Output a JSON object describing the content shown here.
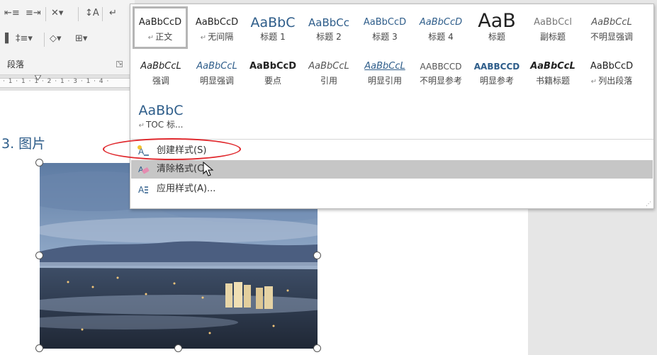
{
  "ribbon": {
    "group_label": "段落",
    "ruler_text": "· 1 · 1 · 1 · 2 · 1 · 3 · 1 · 4 ·"
  },
  "document": {
    "heading": "3. 图片"
  },
  "style_gallery": {
    "items": [
      {
        "sample": "AaBbCcD",
        "name": "正文"
      },
      {
        "sample": "AaBbCcD",
        "name": "无间隔"
      },
      {
        "sample": "AaBbC",
        "name": "标题 1"
      },
      {
        "sample": "AaBbCc",
        "name": "标题 2"
      },
      {
        "sample": "AaBbCcD",
        "name": "标题 3"
      },
      {
        "sample": "AaBbCcD",
        "name": "标题 4"
      },
      {
        "sample": "AaB",
        "name": "标题"
      },
      {
        "sample": "AaBbCcl",
        "name": "副标题"
      },
      {
        "sample": "AaBbCcL",
        "name": "不明显强调"
      },
      {
        "sample": "AaBbCcL",
        "name": "强调"
      },
      {
        "sample": "AaBbCcL",
        "name": "明显强调"
      },
      {
        "sample": "AaBbCcD",
        "name": "要点"
      },
      {
        "sample": "AaBbCcL",
        "name": "引用"
      },
      {
        "sample": "AaBbCcL",
        "name": "明显引用"
      },
      {
        "sample": "AABBCCD",
        "name": "不明显参考"
      },
      {
        "sample": "AABBCCD",
        "name": "明显参考"
      },
      {
        "sample": "AaBbCcL",
        "name": "书籍标题"
      },
      {
        "sample": "AaBbCcD",
        "name": "列出段落"
      },
      {
        "sample": "AaBbC",
        "name": "TOC 标..."
      }
    ],
    "menu": {
      "create": "创建样式(S)",
      "clear": "清除格式(C)",
      "apply": "应用样式(A)..."
    }
  },
  "colors": {
    "heading": "#2e5d8a",
    "highlight_ellipse": "#e0282d",
    "menu_hover": "#c6c6c6"
  }
}
